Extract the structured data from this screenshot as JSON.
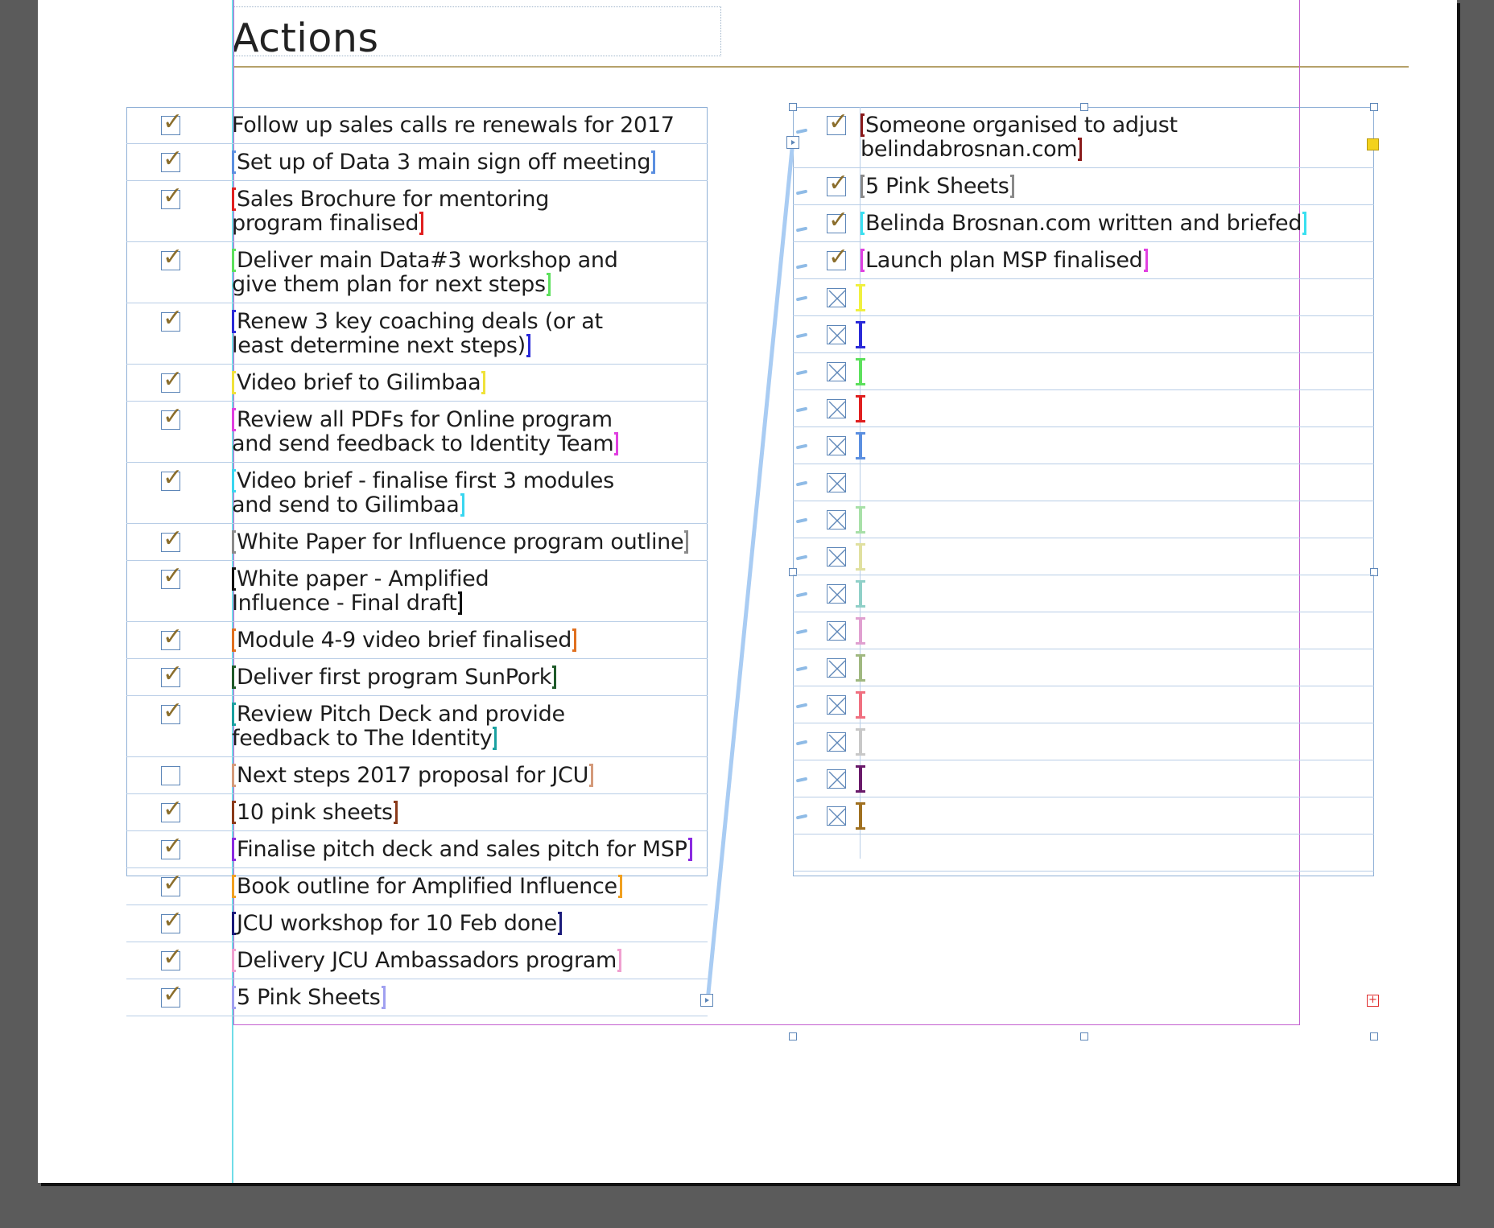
{
  "document": {
    "title": "Actions"
  },
  "colors": {
    "checkmark": "#8b6e2c",
    "frame_border": "#8fb0d6",
    "row_rule": "#b8cde6",
    "guide_magenta": "#c35fcf",
    "guide_cyan": "#6fdde8",
    "gold_rule": "#b5a16a"
  },
  "left_column": {
    "items": [
      {
        "text": "Follow up sales calls re renewals for 2017",
        "checked": true,
        "bracket": ""
      },
      {
        "text": "Set up of Data 3 main sign off meeting",
        "checked": true,
        "bracket": "#5b8fe0"
      },
      {
        "text": "Sales Brochure for mentoring\nprogram finalised",
        "checked": true,
        "bracket": "#e02020"
      },
      {
        "text": "Deliver main Data#3 workshop and\ngive them plan for next steps",
        "checked": true,
        "bracket": "#5de05d"
      },
      {
        "text": "Renew 3 key coaching deals (or at\nleast determine next steps)",
        "checked": true,
        "bracket": "#2a2ad8"
      },
      {
        "text": "Video brief to Gilimbaa",
        "checked": true,
        "bracket": "#f0e23a"
      },
      {
        "text": "Review all PDFs for Online program\nand send feedback to Identity Team",
        "checked": true,
        "bracket": "#e040e0"
      },
      {
        "text": "Video brief - finalise first 3 modules\nand send to Gilimbaa",
        "checked": true,
        "bracket": "#3ad6f0"
      },
      {
        "text": "White Paper for Influence program outline",
        "checked": true,
        "bracket": "#8a8a8a"
      },
      {
        "text": "White paper - Amplified\nInfluence - Final draft",
        "checked": true,
        "bracket": "#111111"
      },
      {
        "text": "Module 4-9 video brief finalised",
        "checked": true,
        "bracket": "#e07020"
      },
      {
        "text": "Deliver first program SunPork",
        "checked": true,
        "bracket": "#1f5a2a"
      },
      {
        "text": "Review Pitch Deck and provide\nfeedback to The Identity",
        "checked": true,
        "bracket": "#1aa0a0"
      },
      {
        "text": "Next steps 2017 proposal for JCU",
        "checked": false,
        "bracket": "#d49a7a"
      },
      {
        "text": "10 pink sheets",
        "checked": true,
        "bracket": "#8a3a1a"
      },
      {
        "text": "Finalise pitch deck and sales pitch for MSP",
        "checked": true,
        "bracket": "#8a2ae0"
      },
      {
        "text": "Book outline for Amplified Influence",
        "checked": true,
        "bracket": "#f0a020"
      },
      {
        "text": "JCU workshop for 10 Feb done",
        "checked": true,
        "bracket": "#1a1a7a"
      },
      {
        "text": "Delivery JCU Ambassadors program",
        "checked": true,
        "bracket": "#f0a0d0"
      },
      {
        "text": "5 Pink Sheets",
        "checked": true,
        "bracket": "#a0a0f0"
      }
    ]
  },
  "right_column": {
    "items": [
      {
        "text": "Someone organised to adjust\nbelindabrosnan.com",
        "checked": true,
        "bracket": "#8a1a1a"
      },
      {
        "text": "5 Pink Sheets",
        "checked": true,
        "bracket": "#8a8a8a"
      },
      {
        "text": "Belinda Brosnan.com written and briefed",
        "checked": true,
        "bracket": "#3ae0f0"
      },
      {
        "text": "Launch plan MSP finalised",
        "checked": true,
        "bracket": "#e040e0"
      }
    ],
    "placeholder_cursor_colors": [
      "#f0f040",
      "#2a2ad8",
      "#5de05d",
      "#e02020",
      "#5b8fe0",
      "",
      "#a8e0a8",
      "#e0e0a0",
      "#90d0c8",
      "#e0a0d0",
      "#a0b880",
      "#f07080",
      "#c8c8c8",
      "#6a1a6a",
      "#a07020"
    ]
  }
}
